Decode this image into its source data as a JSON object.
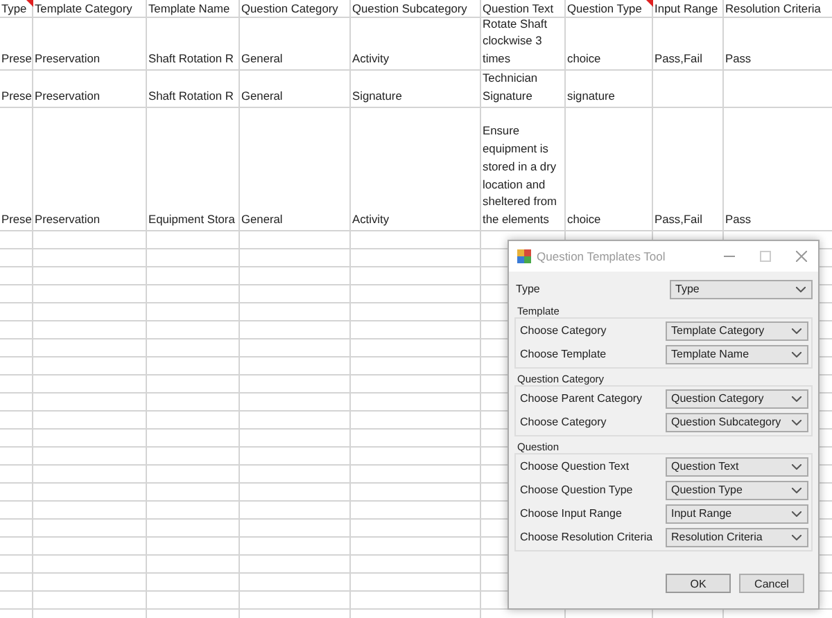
{
  "sheet": {
    "columns": [
      {
        "label": "Type",
        "comment": true
      },
      {
        "label": "Template Category",
        "comment": false
      },
      {
        "label": "Template Name",
        "comment": false
      },
      {
        "label": "Question Category",
        "comment": false
      },
      {
        "label": "Question Subcategory",
        "comment": false
      },
      {
        "label": "Question Text",
        "comment": false
      },
      {
        "label": "Question Type",
        "comment": true
      },
      {
        "label": "Input Range",
        "comment": false
      },
      {
        "label": "Resolution Criteria",
        "comment": false
      }
    ],
    "rows": [
      {
        "kind": "short",
        "cells": [
          "Prese",
          "Preservation",
          "Shaft Rotation R",
          "General",
          "Activity",
          "Rotate Shaft clockwise 3 times",
          "choice",
          "Pass,Fail",
          "Pass"
        ]
      },
      {
        "kind": "shorter",
        "cells": [
          "Prese",
          "Preservation",
          "Shaft Rotation R",
          "General",
          "Signature",
          "Technician Signature",
          "signature",
          "",
          ""
        ]
      },
      {
        "kind": "tall",
        "cells": [
          "Prese",
          "Preservation",
          "Equipment Stora",
          "General",
          "Activity",
          "Ensure equipment is stored in a dry location and sheltered from the elements",
          "choice",
          "Pass,Fail",
          "Pass"
        ]
      }
    ]
  },
  "dialog": {
    "title": "Question Templates Tool",
    "type_field": {
      "label": "Type",
      "value": "Type"
    },
    "groups": [
      {
        "title": "Template",
        "fields": [
          {
            "label": "Choose Category",
            "value": "Template Category"
          },
          {
            "label": "Choose Template",
            "value": "Template Name"
          }
        ]
      },
      {
        "title": "Question Category",
        "fields": [
          {
            "label": "Choose Parent Category",
            "value": "Question Category"
          },
          {
            "label": "Choose Category",
            "value": "Question Subcategory"
          }
        ]
      },
      {
        "title": "Question",
        "fields": [
          {
            "label": "Choose Question Text",
            "value": "Question Text"
          },
          {
            "label": "Choose Question Type",
            "value": "Question Type"
          },
          {
            "label": "Choose Input Range",
            "value": "Input Range"
          },
          {
            "label": "Choose Resolution Criteria",
            "value": "Resolution Criteria"
          }
        ]
      }
    ],
    "buttons": [
      "OK",
      "Cancel"
    ]
  }
}
